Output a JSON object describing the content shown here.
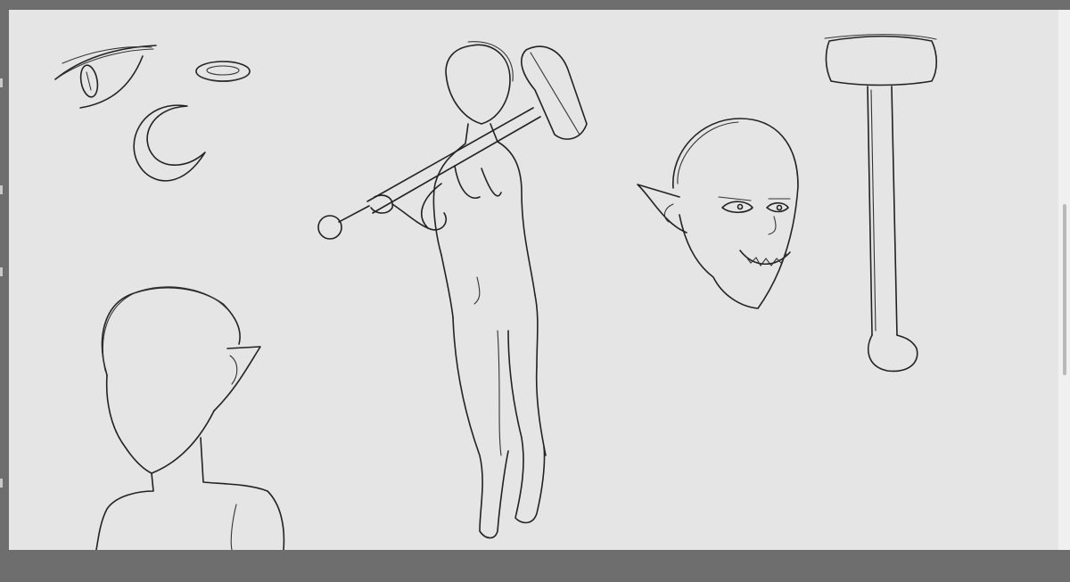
{
  "app": {
    "workspace_color": "#6e6e6e",
    "canvas_color": "#e5e5e5",
    "stroke_color": "#222222"
  },
  "canvas": {
    "sketches": [
      {
        "name": "eye-study",
        "icon": "eye-sketch"
      },
      {
        "name": "ring-study",
        "icon": "ring-sketch"
      },
      {
        "name": "crescent-moon-study",
        "icon": "crescent-sketch"
      },
      {
        "name": "figure-with-hammer",
        "icon": "figure-sketch"
      },
      {
        "name": "goblin-head",
        "icon": "head-sketch"
      },
      {
        "name": "hammer-study",
        "icon": "hammer-sketch"
      },
      {
        "name": "bust-study",
        "icon": "bust-sketch"
      }
    ]
  },
  "scrollbar": {
    "orientation": "vertical",
    "position": 0.35
  }
}
